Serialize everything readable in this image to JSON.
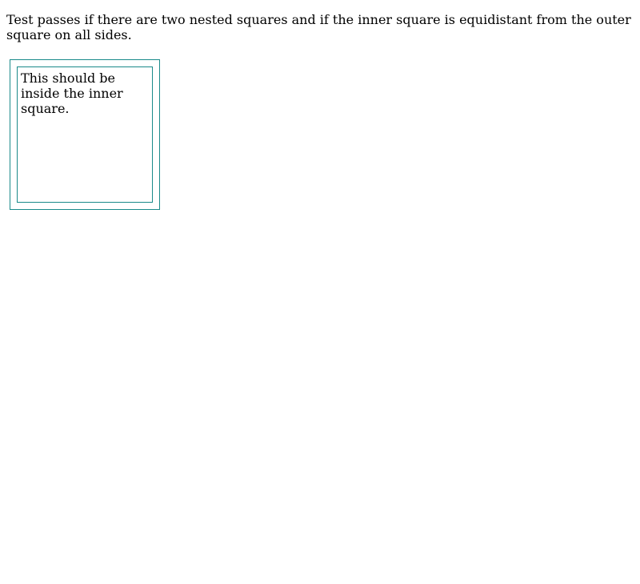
{
  "instructions": "Test passes if there are two nested squares and if the inner square is equidistant from the outer square on all sides.",
  "inner_text": "This should be inside the inner square.",
  "colors": {
    "square_border": "#1a8a8a",
    "text": "#000000",
    "background": "#ffffff"
  }
}
